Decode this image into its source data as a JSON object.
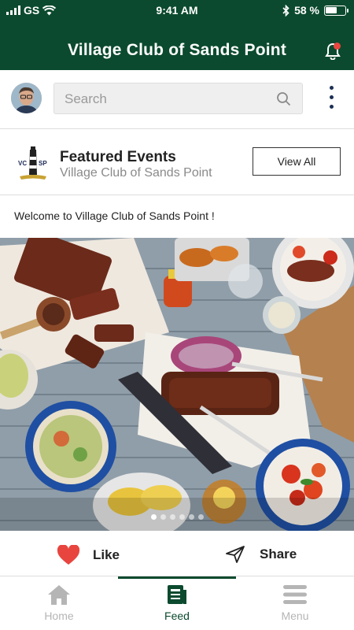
{
  "status_bar": {
    "carrier": "GS",
    "time": "9:41 AM",
    "battery": "58 %"
  },
  "header": {
    "title": "Village Club of Sands Point"
  },
  "search": {
    "placeholder": "Search"
  },
  "featured": {
    "logo_text_left": "VC",
    "logo_text_right": "SP",
    "title": "Featured Events",
    "subtitle": "Village Club of Sands Point",
    "view_all_label": "View All"
  },
  "post": {
    "message": "Welcome to Village Club of Sands Point !",
    "image_icon": "food-spread-photo",
    "carousel": {
      "count": 6,
      "active_index": 0
    }
  },
  "actions": {
    "like_label": "Like",
    "share_label": "Share"
  },
  "tabbar": {
    "tabs": [
      {
        "label": "Home",
        "icon": "home-icon",
        "active": false
      },
      {
        "label": "Feed",
        "icon": "feed-icon",
        "active": true
      },
      {
        "label": "Menu",
        "icon": "menu-icon",
        "active": false
      }
    ]
  },
  "colors": {
    "brand_green": "#0b4a2e",
    "notification_red": "#e8463f",
    "like_red": "#e8453f"
  }
}
